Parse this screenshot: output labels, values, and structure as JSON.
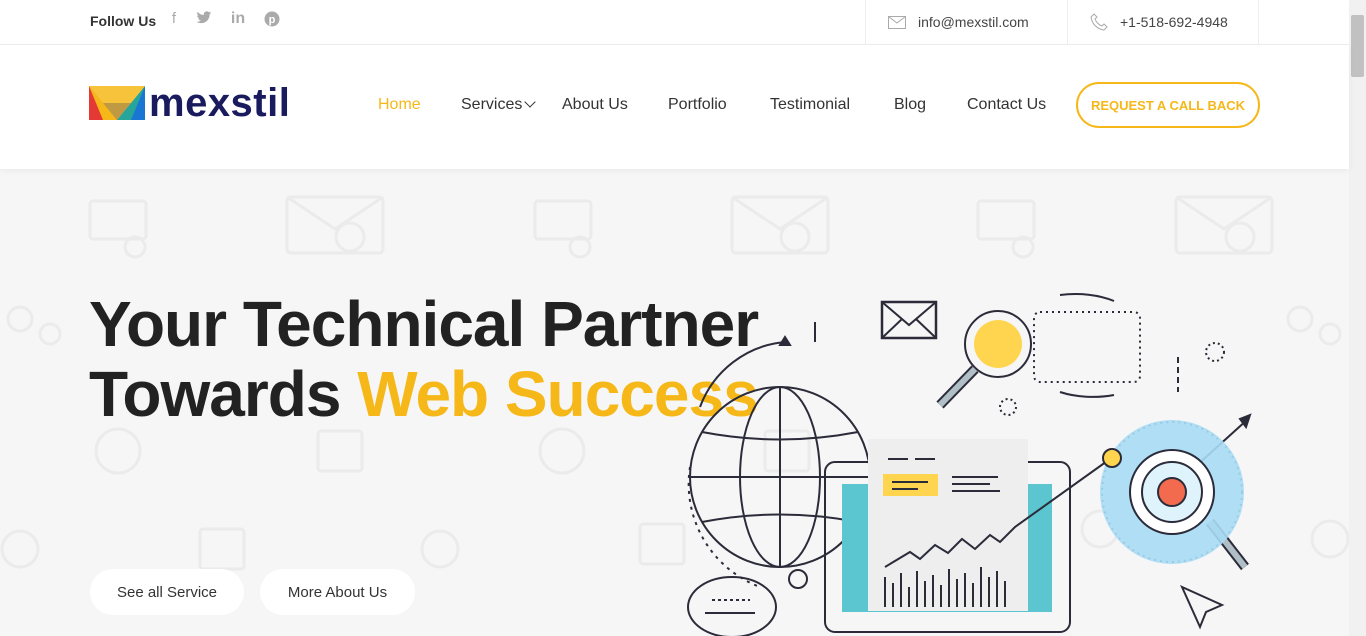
{
  "topbar": {
    "follow_label": "Follow Us",
    "social_icons": [
      "facebook-icon",
      "twitter-icon",
      "linkedin-icon",
      "pinterest-icon"
    ],
    "email": "info@mexstil.com",
    "phone": "+1-518-692-4948"
  },
  "header": {
    "logo_text": "mexstil",
    "nav": [
      {
        "label": "Home",
        "active": true
      },
      {
        "label": "Services",
        "has_dropdown": true
      },
      {
        "label": "About Us"
      },
      {
        "label": "Portfolio"
      },
      {
        "label": "Testimonial"
      },
      {
        "label": "Blog"
      },
      {
        "label": "Contact Us"
      }
    ],
    "cta_label": "REQUEST A CALL BACK"
  },
  "hero": {
    "title_line1": "Your Technical Partner",
    "title_line2_plain": "Towards ",
    "title_line2_accent": "Web Success",
    "buttons": {
      "services": "See all Service",
      "about": "More About Us"
    }
  },
  "colors": {
    "accent": "#f6b818",
    "dark": "#222222",
    "logo_blue": "#1a1a5e",
    "teal": "#5bc6d0",
    "light_blue": "#a8dcf5"
  }
}
